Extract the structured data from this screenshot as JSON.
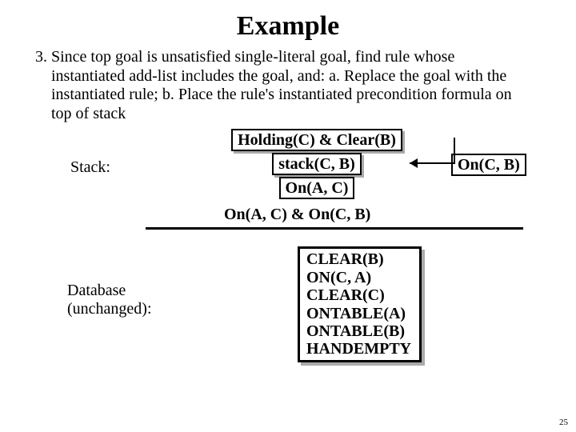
{
  "title": "Example",
  "body": "3. Since top goal is unsatisfied single-literal goal, find rule whose instantiated add-list includes the goal, and:  a. Replace the goal with the instantiated rule; b. Place the rule's instantiated precondition formula on top of stack",
  "stack": {
    "label": "Stack:",
    "items": [
      "Holding(C) & Clear(B)",
      "stack(C, B)",
      "On(A, C)"
    ],
    "conj": "On(A, C) & On(C, B)"
  },
  "on_cb": "On(C, B)",
  "database": {
    "label": "Database (unchanged):",
    "lines": [
      "CLEAR(B)",
      "ON(C, A)",
      "CLEAR(C)",
      "ONTABLE(A)",
      "ONTABLE(B)",
      "HANDEMPTY"
    ]
  },
  "page": "25"
}
